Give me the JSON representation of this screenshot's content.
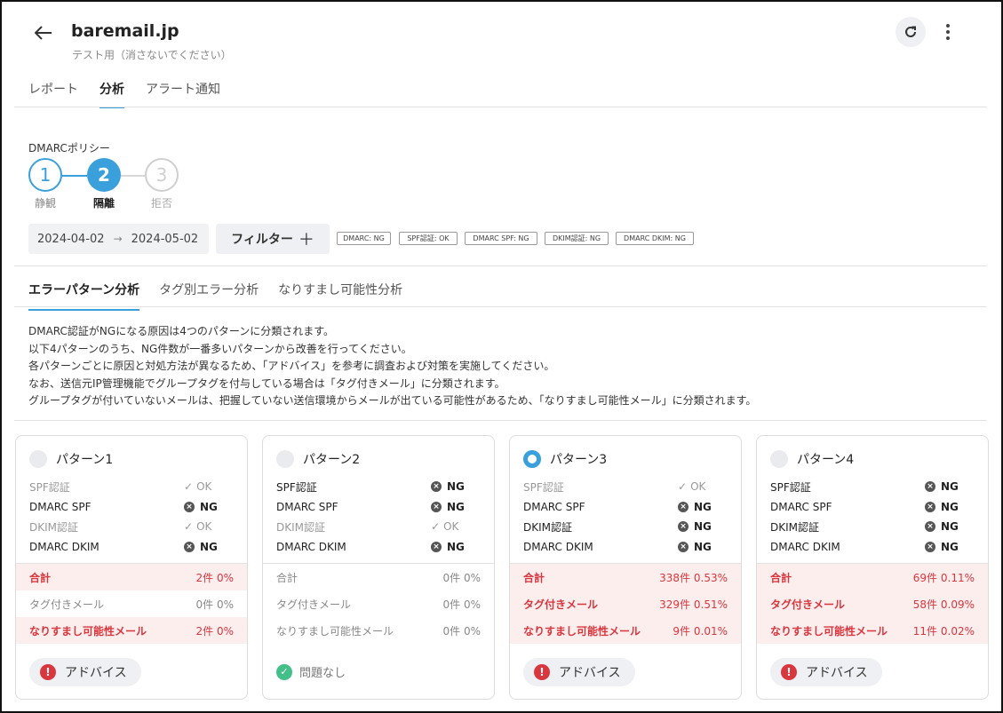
{
  "header": {
    "title": "baremail.jp",
    "subtitle": "テスト用（消さないでください）"
  },
  "top_tabs": [
    {
      "label": "レポート",
      "active": false
    },
    {
      "label": "分析",
      "active": true
    },
    {
      "label": "アラート通知",
      "active": false
    }
  ],
  "policy": {
    "label": "DMARCポリシー",
    "steps": [
      {
        "num": "1",
        "label": "静観",
        "state": "done"
      },
      {
        "num": "2",
        "label": "隔離",
        "state": "current"
      },
      {
        "num": "3",
        "label": "拒否",
        "state": "pending"
      }
    ]
  },
  "filters": {
    "date_from": "2024-04-02",
    "date_to": "2024-05-02",
    "filter_label": "フィルター",
    "chips": [
      "DMARC: NG",
      "SPF認証: OK",
      "DMARC SPF: NG",
      "DKIM認証: NG",
      "DMARC DKIM: NG"
    ]
  },
  "sub_tabs": [
    {
      "label": "エラーパターン分析",
      "active": true
    },
    {
      "label": "タグ別エラー分析",
      "active": false
    },
    {
      "label": "なりすまし可能性分析",
      "active": false
    }
  ],
  "description": [
    "DMARC認証がNGになる原因は4つのパターンに分類されます。",
    "以下4パターンのうち、NG件数が一番多いパターンから改善を行ってください。",
    "各パターンごとに原因と対処方法が異なるため、「アドバイス」を参考に調査および対策を実施してください。",
    "なお、送信元IP管理機能でグループタグを付与している場合は「タグ付きメール」に分類されます。",
    "グループタグが付いていないメールは、把握していない送信環境からメールが出ている可能性があるため、「なりすまし可能性メール」に分類されます。"
  ],
  "patterns": [
    {
      "title": "パターン1",
      "selected": false,
      "checks": [
        {
          "name": "SPF認証",
          "status": "OK"
        },
        {
          "name": "DMARC SPF",
          "status": "NG"
        },
        {
          "name": "DKIM認証",
          "status": "OK"
        },
        {
          "name": "DMARC DKIM",
          "status": "NG"
        }
      ],
      "stats": [
        {
          "name": "合計",
          "value": "2件 0%",
          "highlight": true
        },
        {
          "name": "タグ付きメール",
          "value": "0件 0%",
          "highlight": false
        },
        {
          "name": "なりすまし可能性メール",
          "value": "2件 0%",
          "highlight": true
        }
      ],
      "action": {
        "type": "advice",
        "label": "アドバイス"
      }
    },
    {
      "title": "パターン2",
      "selected": false,
      "checks": [
        {
          "name": "SPF認証",
          "status": "NG"
        },
        {
          "name": "DMARC SPF",
          "status": "NG"
        },
        {
          "name": "DKIM認証",
          "status": "OK"
        },
        {
          "name": "DMARC DKIM",
          "status": "NG"
        }
      ],
      "stats": [
        {
          "name": "合計",
          "value": "0件 0%",
          "highlight": false
        },
        {
          "name": "タグ付きメール",
          "value": "0件 0%",
          "highlight": false
        },
        {
          "name": "なりすまし可能性メール",
          "value": "0件 0%",
          "highlight": false
        }
      ],
      "action": {
        "type": "ok",
        "label": "問題なし"
      }
    },
    {
      "title": "パターン3",
      "selected": true,
      "checks": [
        {
          "name": "SPF認証",
          "status": "OK"
        },
        {
          "name": "DMARC SPF",
          "status": "NG"
        },
        {
          "name": "DKIM認証",
          "status": "NG"
        },
        {
          "name": "DMARC DKIM",
          "status": "NG"
        }
      ],
      "stats": [
        {
          "name": "合計",
          "value": "338件 0.53%",
          "highlight": true
        },
        {
          "name": "タグ付きメール",
          "value": "329件 0.51%",
          "highlight": true
        },
        {
          "name": "なりすまし可能性メール",
          "value": "9件 0.01%",
          "highlight": true
        }
      ],
      "action": {
        "type": "advice",
        "label": "アドバイス"
      }
    },
    {
      "title": "パターン4",
      "selected": false,
      "checks": [
        {
          "name": "SPF認証",
          "status": "NG"
        },
        {
          "name": "DMARC SPF",
          "status": "NG"
        },
        {
          "name": "DKIM認証",
          "status": "NG"
        },
        {
          "name": "DMARC DKIM",
          "status": "NG"
        }
      ],
      "stats": [
        {
          "name": "合計",
          "value": "69件 0.11%",
          "highlight": true
        },
        {
          "name": "タグ付きメール",
          "value": "58件 0.09%",
          "highlight": true
        },
        {
          "name": "なりすまし可能性メール",
          "value": "11件 0.02%",
          "highlight": true
        }
      ],
      "action": {
        "type": "advice",
        "label": "アドバイス"
      }
    }
  ]
}
